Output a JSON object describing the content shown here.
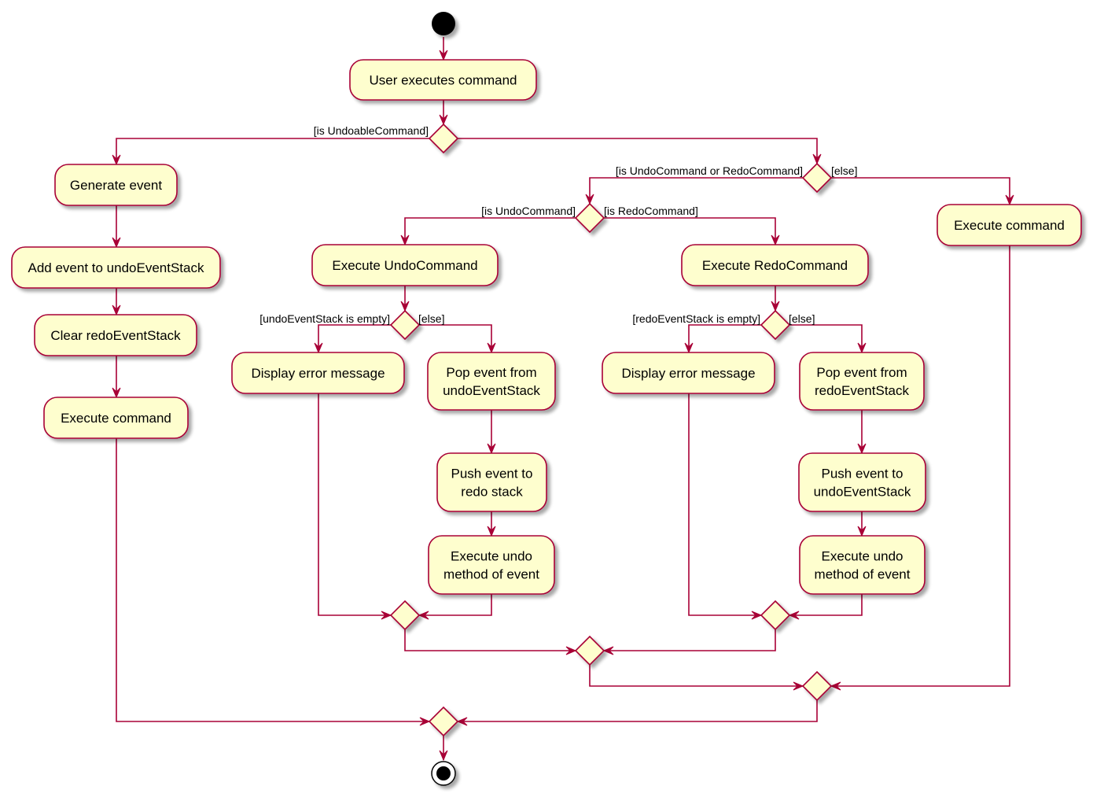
{
  "diagram": {
    "type": "UML activity diagram",
    "colors": {
      "line": "#A80036",
      "activity_fill": "#FEFECE",
      "start_fill": "#000000",
      "shadow": "#c8c8c8"
    },
    "start": {
      "label": "start"
    },
    "end": {
      "label": "end"
    },
    "activities": {
      "user_executes": {
        "lines": [
          "User executes command"
        ]
      },
      "generate_event": {
        "lines": [
          "Generate event"
        ]
      },
      "add_event": {
        "lines": [
          "Add event to undoEventStack"
        ]
      },
      "clear_redo": {
        "lines": [
          "Clear redoEventStack"
        ]
      },
      "execute_command_left": {
        "lines": [
          "Execute command"
        ]
      },
      "execute_undo_command": {
        "lines": [
          "Execute UndoCommand"
        ]
      },
      "execute_redo_command": {
        "lines": [
          "Execute RedoCommand"
        ]
      },
      "execute_command_right": {
        "lines": [
          "Execute command"
        ]
      },
      "display_error_undo": {
        "lines": [
          "Display error message"
        ]
      },
      "pop_undo": {
        "lines": [
          "Pop event from",
          "undoEventStack"
        ]
      },
      "push_redo": {
        "lines": [
          "Push event to",
          "redo stack"
        ]
      },
      "exec_undo_method_1": {
        "lines": [
          "Execute undo",
          "method of event"
        ]
      },
      "display_error_redo": {
        "lines": [
          "Display error message"
        ]
      },
      "pop_redo": {
        "lines": [
          "Pop event from",
          "redoEventStack"
        ]
      },
      "push_undo": {
        "lines": [
          "Push event to",
          "undoEventStack"
        ]
      },
      "exec_undo_method_2": {
        "lines": [
          "Execute undo",
          "method of event"
        ]
      }
    },
    "guards": {
      "is_undoable": "[is UndoableCommand]",
      "is_undo_or_redo": "[is UndoCommand or RedoCommand]",
      "else_top": "[else]",
      "is_undo": "[is UndoCommand]",
      "is_redo": "[is RedoCommand]",
      "undo_empty": "[undoEventStack is empty]",
      "else_undo": "[else]",
      "redo_empty": "[redoEventStack is empty]",
      "else_redo": "[else]"
    }
  }
}
